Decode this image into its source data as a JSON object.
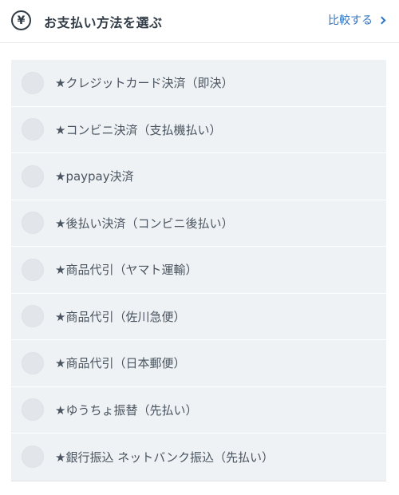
{
  "header": {
    "title": "お支払い方法を選ぶ",
    "compare_label": "比較する",
    "yen_icon": "yen-circle-icon",
    "chevron_icon": "chevron-right-icon",
    "accent_color": "#2f74c0"
  },
  "payment_methods": [
    {
      "label": "★クレジットカード決済（即決）",
      "selected": false
    },
    {
      "label": "★コンビニ決済（支払機払い）",
      "selected": false
    },
    {
      "label": "★paypay決済",
      "selected": false
    },
    {
      "label": "★後払い決済（コンビニ後払い）",
      "selected": false
    },
    {
      "label": "★商品代引（ヤマト運輸）",
      "selected": false
    },
    {
      "label": "★商品代引（佐川急便）",
      "selected": false
    },
    {
      "label": "★商品代引（日本郵便）",
      "selected": false
    },
    {
      "label": "★ゆうちょ振替（先払い）",
      "selected": false
    },
    {
      "label": "★銀行振込 ネットバンク振込（先払い）",
      "selected": false
    }
  ]
}
